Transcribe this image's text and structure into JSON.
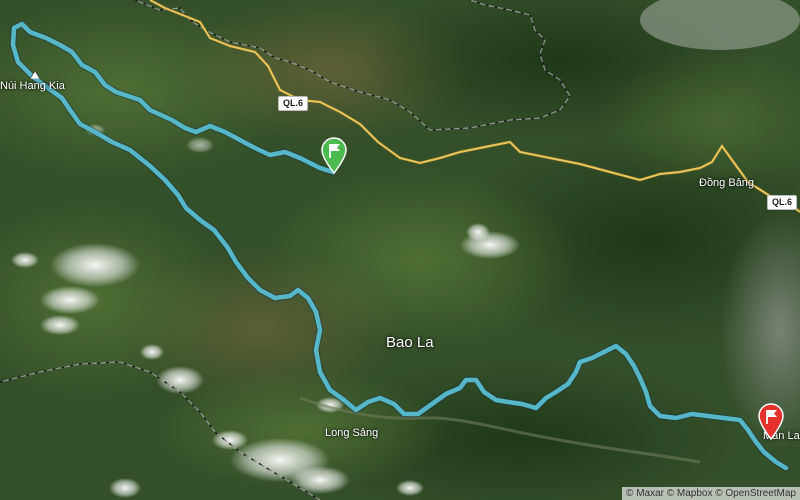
{
  "map": {
    "colors": {
      "route": "#56b7c8",
      "road": "#e8c75e",
      "border": "#1c1c1c",
      "start_flag": "#4cbb4f",
      "finish_flag": "#e5322d"
    },
    "labels": {
      "nui_hang_kia": "Núi Hang Kia",
      "bao_la": "Bao La",
      "long_sang": "Long Sảng",
      "dong_bang": "Đồng Bảng",
      "man_la": "Mán La"
    },
    "road_shields": [
      "QL.6",
      "QL.6"
    ],
    "markers": {
      "start_icon": "start-flag-icon",
      "finish_icon": "finish-flag-icon",
      "peak_icon": "mountain-peak-icon"
    },
    "attribution": "© Maxar © Mapbox © OpenStreetMap"
  }
}
